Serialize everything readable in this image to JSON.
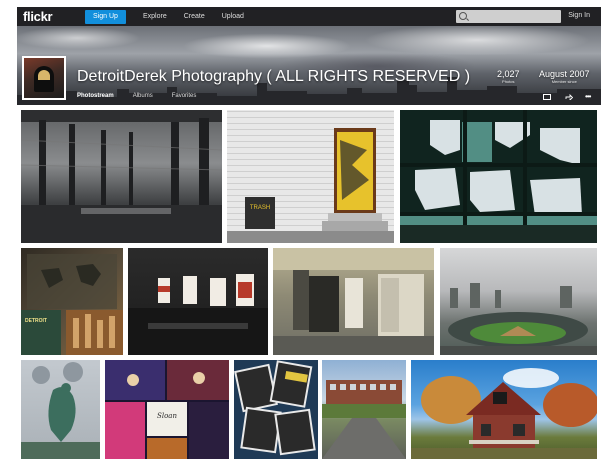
{
  "topbar": {
    "logo": "flickr",
    "signup_label": "Sign Up",
    "nav": [
      "Explore",
      "Create",
      "Upload"
    ],
    "search_placeholder": "",
    "signin_label": "Sign In"
  },
  "profile": {
    "name": "DetroitDerek Photography ( ALL RIGHTS RESERVED )",
    "photos_count": "2,027",
    "photos_label": "Photos",
    "member_since": "August 2007",
    "member_since_label": "Member since",
    "tabs": [
      "Photostream",
      "Albums",
      "Favorites"
    ],
    "active_tab": "Photostream"
  },
  "photos": {
    "row1": [
      "abandoned-factory-interior",
      "painted-door-on-brick-wall",
      "broken-window-panes"
    ],
    "row2": [
      "detroit-map-collage",
      "dark-interior-with-windows",
      "decayed-hallway-doors",
      "stadium-aerial-view"
    ],
    "row3": [
      "spirit-of-detroit-statue",
      "concert-collage",
      "magazine-cover-collage",
      "road-toward-abandoned-building",
      "abandoned-house-autumn"
    ],
    "text_in_photos": {
      "trash_can": "TRASH",
      "map_caption": "DETROIT",
      "collage_caption": "Sloan"
    }
  },
  "colors": {
    "topbar_bg": "#212124",
    "signup_bg": "#128fdc",
    "page_bg": "#ffffff"
  }
}
